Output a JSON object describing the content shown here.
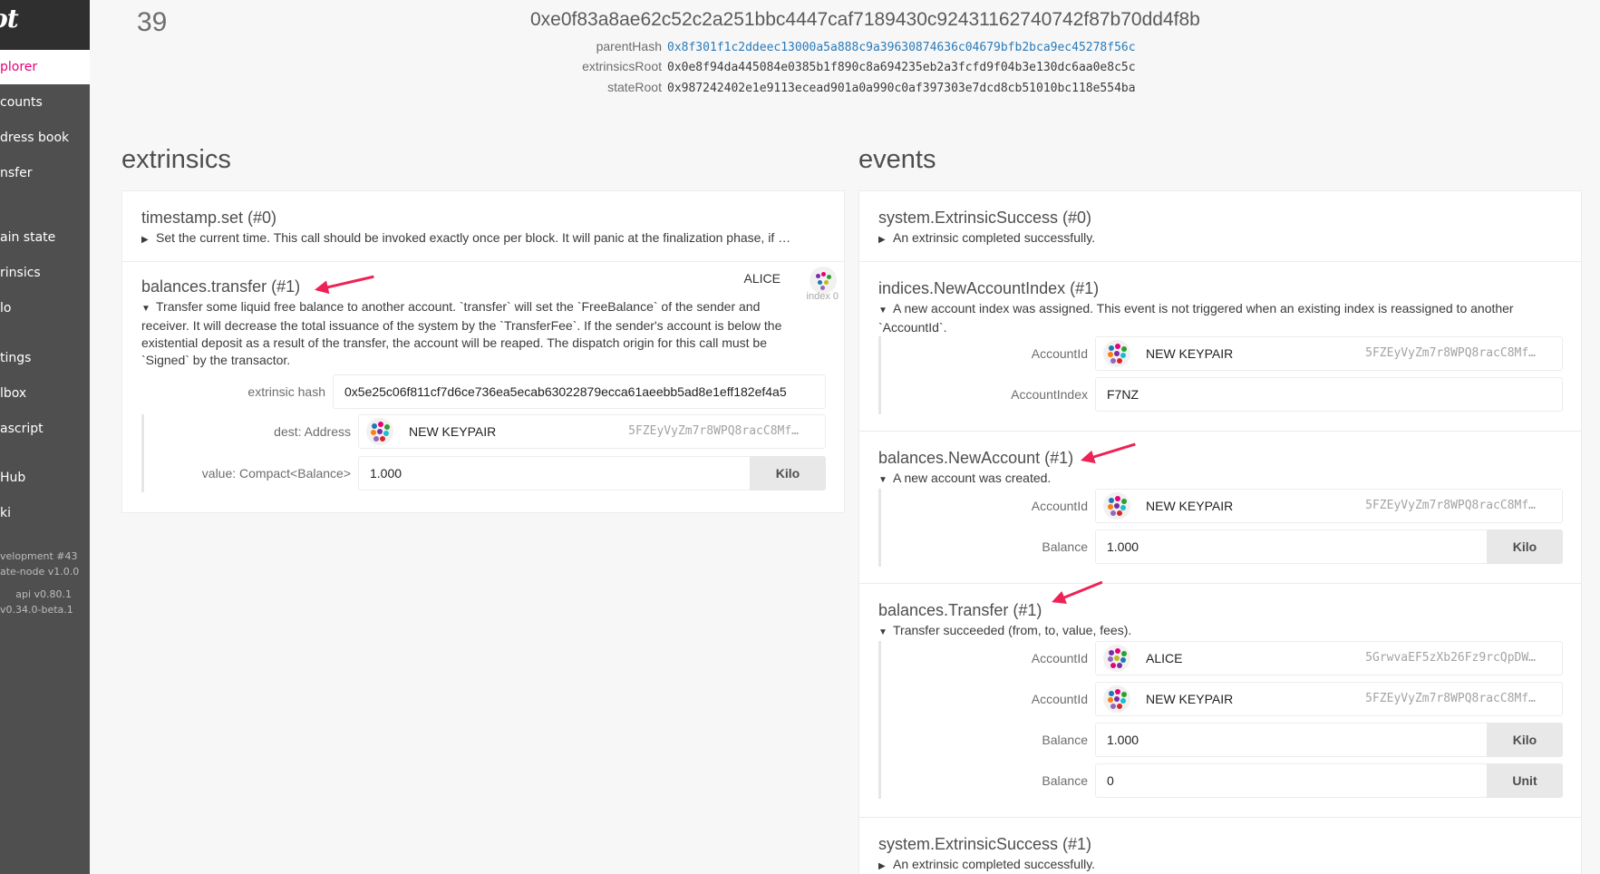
{
  "app": {
    "logo_text": "kadot",
    "logo_dot": "."
  },
  "sidebar": {
    "items": [
      {
        "label": "plorer",
        "active": true
      },
      {
        "label": "counts"
      },
      {
        "label": "dress book"
      },
      {
        "label": "nsfer"
      },
      {
        "label": "ain state"
      },
      {
        "label": "rinsics"
      },
      {
        "label": "lo"
      },
      {
        "label": "tings"
      },
      {
        "label": "lbox"
      },
      {
        "label": "ascript"
      },
      {
        "label": "Hub"
      },
      {
        "label": "ki"
      }
    ],
    "footer": [
      "velopment #43",
      "ate-node v1.0.0",
      "api v0.80.1",
      "v0.34.0-beta.1"
    ]
  },
  "block": {
    "number": "39",
    "hash": "0xe0f83a8ae62c52c2a251bbc4447caf7189430c92431162740742f87b70dd4f8b",
    "rows": [
      {
        "key": "parentHash",
        "value": "0x8f301f1c2ddeec13000a5a888c9a39630874636c04679bfb2bca9ec45278f56c"
      },
      {
        "key": "extrinsicsRoot",
        "value": "0x0e8f94da445084e0385b1f890c8a694235eb2a3fcfd9f04b3e130dc6aa0e8c5c"
      },
      {
        "key": "stateRoot",
        "value": "0x987242402e1e9113ecead901a0a990c0af397303e7dcd8cb51010bc118e554ba"
      }
    ]
  },
  "extrinsics": {
    "title": "extrinsics",
    "items": [
      {
        "title": "timestamp.set (#0)",
        "desc": "Set the current time. This call should be invoked exactly once per block. It will panic at the finalization phase, if …"
      },
      {
        "title": "balances.transfer (#1)",
        "signer": "ALICE",
        "signer_index": "index 0",
        "desc_lines": [
          "Transfer some liquid free balance to another account. `transfer` will set the `FreeBalance` of the sender and",
          "receiver. It will decrease the total issuance of the system by the `TransferFee`. If the sender's account is below the",
          "existential deposit as a result of the transfer, the account will be reaped. The dispatch origin for this call must be",
          "`Signed` by the transactor."
        ],
        "hash_label": "extrinsic hash",
        "hash_value": "0x5e25c06f811cf7d6ce736ea5ecab63022879ecca61aeebb5ad8e1eff182ef4a5",
        "dest_label": "dest: Address",
        "dest_name": "NEW KEYPAIR",
        "dest_addr": "5FZEyVyZm7r8WPQ8racC8Mf…",
        "value_label": "value: Compact<Balance>",
        "value": "1.000",
        "value_unit": "Kilo"
      }
    ]
  },
  "events": {
    "title": "events",
    "items": [
      {
        "title": "system.ExtrinsicSuccess (#0)",
        "desc": "An extrinsic completed successfully."
      },
      {
        "title": "indices.NewAccountIndex (#1)",
        "desc_lines": [
          "A new account index was assigned. This event is not triggered when an existing index is reassigned to another",
          "`AccountId`."
        ],
        "fields": [
          {
            "label": "AccountId",
            "name": "NEW KEYPAIR",
            "addr": "5FZEyVyZm7r8WPQ8racC8Mf…"
          },
          {
            "label": "AccountIndex",
            "value": "F7NZ"
          }
        ]
      },
      {
        "title": "balances.NewAccount (#1)",
        "desc": "A new account was created.",
        "fields": [
          {
            "label": "AccountId",
            "name": "NEW KEYPAIR",
            "addr": "5FZEyVyZm7r8WPQ8racC8Mf…"
          },
          {
            "label": "Balance",
            "value": "1.000",
            "unit": "Kilo"
          }
        ]
      },
      {
        "title": "balances.Transfer (#1)",
        "desc": "Transfer succeeded (from, to, value, fees).",
        "fields": [
          {
            "label": "AccountId",
            "name": "ALICE",
            "addr": "5GrwvaEF5zXb26Fz9rcQpDW…"
          },
          {
            "label": "AccountId",
            "name": "NEW KEYPAIR",
            "addr": "5FZEyVyZm7r8WPQ8racC8Mf…"
          },
          {
            "label": "Balance",
            "value": "1.000",
            "unit": "Kilo"
          },
          {
            "label": "Balance",
            "value": "0",
            "unit": "Unit"
          }
        ]
      },
      {
        "title": "system.ExtrinsicSuccess (#1)",
        "desc": "An extrinsic completed successfully."
      }
    ]
  },
  "colors": {
    "accent": "#e6007a",
    "sidebar": "#4f4f4f",
    "link": "#2a7ab8",
    "annotation_arrow": "#ee2255"
  }
}
